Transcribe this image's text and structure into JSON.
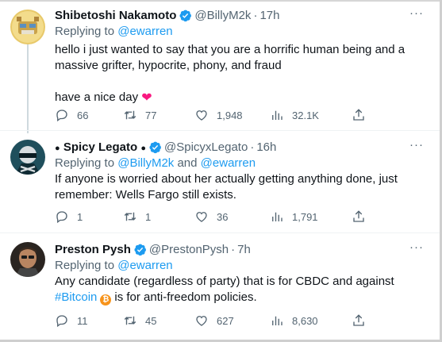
{
  "tweets": [
    {
      "name": "Shibetoshi Nakamoto",
      "handle": "@BillyM2k",
      "time": "17h",
      "reply_prefix": "Replying to",
      "reply_to": [
        "@ewarren"
      ],
      "text_lines": [
        "hello i just wanted to say that you are a horrific human being and a",
        "massive grifter, hypocrite, phony, and fraud",
        "",
        "have a nice day"
      ],
      "emoji": "heart",
      "replies": "66",
      "retweets": "77",
      "likes": "1,948",
      "views": "32.1K"
    },
    {
      "name": "Spicy Legato",
      "handle": "@SpicyxLegato",
      "time": "16h",
      "reply_prefix": "Replying to",
      "reply_to": [
        "@BillyM2k",
        "@ewarren"
      ],
      "reply_join": "and",
      "text_lines": [
        "If anyone is worried about her actually getting anything done, just",
        "remember: Wells Fargo still exists."
      ],
      "replies": "1",
      "retweets": "1",
      "likes": "36",
      "views": "1,791"
    },
    {
      "name": "Preston Pysh",
      "handle": "@PrestonPysh",
      "time": "7h",
      "reply_prefix": "Replying to",
      "reply_to": [
        "@ewarren"
      ],
      "text_lines": [
        "Any candidate (regardless of party) that is for CBDC and against",
        "is for anti-freedom policies."
      ],
      "hashtag": "#Bitcoin",
      "replies": "11",
      "retweets": "45",
      "likes": "627",
      "views": "8,630"
    }
  ],
  "name_glyph": "●",
  "more_glyph": "···",
  "colors": {
    "link": "#1d9bf0",
    "verified": "#1d9bf0",
    "secondary": "#536471",
    "heart": "#f91880",
    "bitcoin": "#f7931a"
  },
  "icons": [
    "verified-badge-icon",
    "more-icon",
    "reply-icon",
    "retweet-icon",
    "like-icon",
    "views-icon",
    "share-icon",
    "heart-emoji-icon",
    "bitcoin-emoji-icon"
  ]
}
